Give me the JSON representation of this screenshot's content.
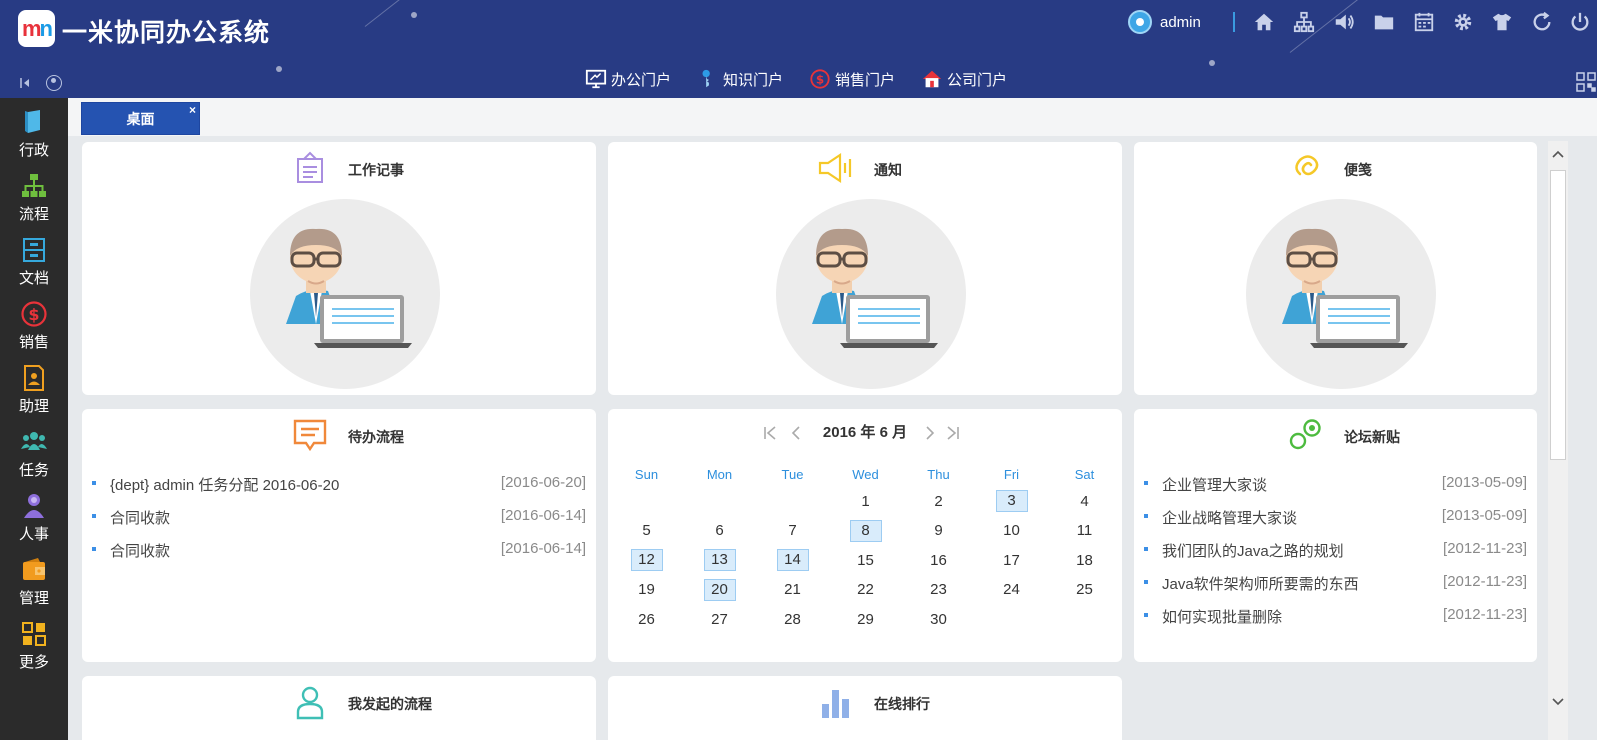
{
  "app": {
    "title": "一米协同办公系统",
    "logo_left": "m",
    "logo_right": "n",
    "user": "admin"
  },
  "header_icons": [
    "home-icon",
    "org-chart-icon",
    "speaker-icon",
    "folder-icon",
    "calendar-icon",
    "gear-icon",
    "tshirt-icon",
    "refresh-icon",
    "power-icon"
  ],
  "portals": [
    {
      "label": "办公门户",
      "icon": "monitor-icon"
    },
    {
      "label": "知识门户",
      "icon": "key-icon"
    },
    {
      "label": "销售门户",
      "icon": "dollar-icon"
    },
    {
      "label": "公司门户",
      "icon": "house-icon"
    }
  ],
  "sidebar": [
    {
      "label": "行政",
      "icon": "book-icon",
      "color": "#4fb8e8"
    },
    {
      "label": "流程",
      "icon": "flow-icon",
      "color": "#6fbf3e"
    },
    {
      "label": "文档",
      "icon": "cabinet-icon",
      "color": "#36a9dd"
    },
    {
      "label": "销售",
      "icon": "dollar-circle-icon",
      "color": "#e8333a"
    },
    {
      "label": "助理",
      "icon": "assistant-icon",
      "color": "#f0a020"
    },
    {
      "label": "任务",
      "icon": "team-icon",
      "color": "#3fb8b0"
    },
    {
      "label": "人事",
      "icon": "person-icon",
      "color": "#8e6fdc"
    },
    {
      "label": "管理",
      "icon": "wallet-icon",
      "color": "#f19b1e"
    },
    {
      "label": "更多",
      "icon": "grid-icon",
      "color": "#f1b21e"
    }
  ],
  "tabs": {
    "desk": "桌面",
    "close": "×"
  },
  "panels": {
    "work_notes": {
      "title": "工作记事"
    },
    "notice": {
      "title": "通知"
    },
    "memo": {
      "title": "便笺"
    },
    "todo": {
      "title": "待办流程",
      "items": [
        {
          "text": "{dept} admin 任务分配 2016-06-20",
          "date": "[2016-06-20]"
        },
        {
          "text": "合同收款",
          "date": "[2016-06-14]"
        },
        {
          "text": "合同收款",
          "date": "[2016-06-14]"
        }
      ]
    },
    "forum": {
      "title": "论坛新贴",
      "items": [
        {
          "text": "企业管理大家谈",
          "date": "[2013-05-09]"
        },
        {
          "text": "企业战略管理大家谈",
          "date": "[2013-05-09]"
        },
        {
          "text": "我们团队的Java之路的规划",
          "date": "[2012-11-23]"
        },
        {
          "text": "Java软件架构师所要需的东西",
          "date": "[2012-11-23]"
        },
        {
          "text": "如何实现批量删除",
          "date": "[2012-11-23]"
        }
      ]
    },
    "my_flows": {
      "title": "我发起的流程"
    },
    "online_rank": {
      "title": "在线排行"
    }
  },
  "calendar": {
    "title": "2016 年 6 月",
    "weekdays": [
      "Sun",
      "Mon",
      "Tue",
      "Wed",
      "Thu",
      "Fri",
      "Sat"
    ],
    "weeks": [
      [
        "",
        "",
        "",
        "1",
        "2",
        "3",
        "4"
      ],
      [
        "5",
        "6",
        "7",
        "8",
        "9",
        "10",
        "11"
      ],
      [
        "12",
        "13",
        "14",
        "15",
        "16",
        "17",
        "18"
      ],
      [
        "19",
        "20",
        "21",
        "22",
        "23",
        "24",
        "25"
      ],
      [
        "26",
        "27",
        "28",
        "29",
        "30",
        "",
        ""
      ]
    ],
    "marked_days": [
      "3",
      "8",
      "12",
      "13",
      "14",
      "20"
    ]
  }
}
